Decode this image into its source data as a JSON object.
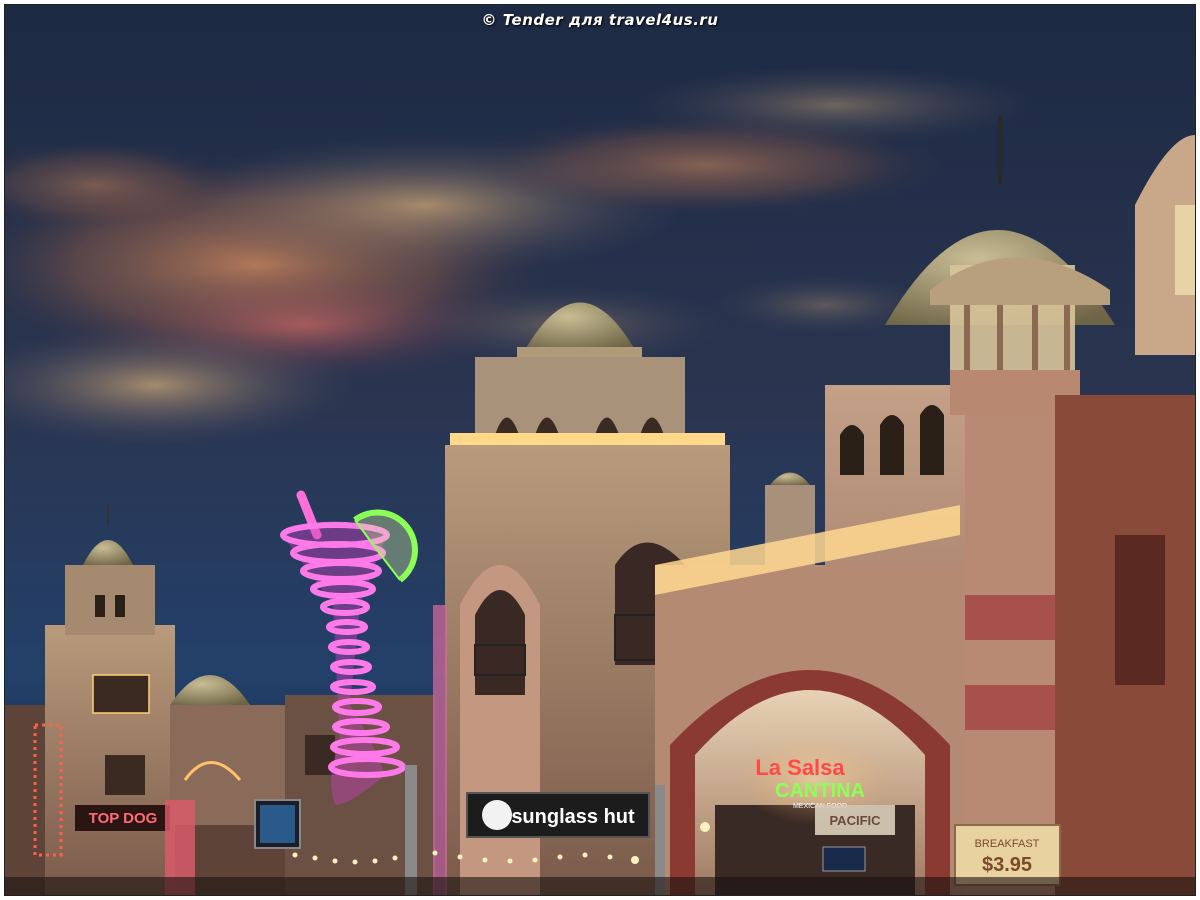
{
  "watermark": "© Tender для travel4us.ru",
  "signs": {
    "sunglass_hut": "sunglass hut",
    "la_salsa_line1": "La Salsa",
    "la_salsa_line2": "CANTINA",
    "la_salsa_sub": "MEXICAN FOOD",
    "pacific": "PACIFIC",
    "breakfast_line1": "BREAKFAST",
    "breakfast_line2": "$3.95",
    "left_neon": "TOP DOG"
  },
  "colors": {
    "sky_top": "#1d2a44",
    "cloud_warm": "#b07a4a",
    "neon_pink": "#ff4fe0",
    "neon_green": "#7dff4f",
    "neon_red": "#ff3b3b",
    "building": "#a88470",
    "dome": "#9f9270"
  }
}
